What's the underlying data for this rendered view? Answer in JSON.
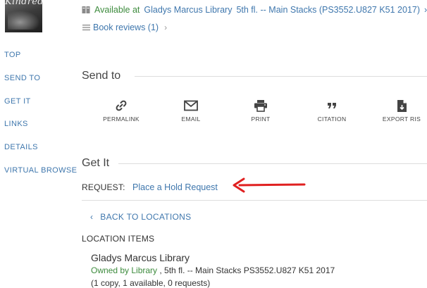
{
  "cover": {
    "title_text": "Kindred"
  },
  "availability": {
    "status": "Available at",
    "library": "Gladys Marcus Library",
    "location": "5th fl. -- Main Stacks (PS3552.U827 K51 2017)",
    "overflow_glyph": "›"
  },
  "reviews": {
    "label": "Book reviews (1)",
    "chevron": "›"
  },
  "nav": {
    "items": [
      "TOP",
      "SEND TO",
      "GET IT",
      "LINKS",
      "DETAILS",
      "VIRTUAL BROWSE"
    ]
  },
  "send_to": {
    "title": "Send to",
    "actions": [
      {
        "label": "PERMALINK",
        "icon": "link-icon"
      },
      {
        "label": "EMAIL",
        "icon": "email-icon"
      },
      {
        "label": "PRINT",
        "icon": "print-icon"
      },
      {
        "label": "CITATION",
        "icon": "quote-icon"
      },
      {
        "label": "EXPORT RIS",
        "icon": "file-export-icon"
      }
    ]
  },
  "get_it": {
    "title": "Get It",
    "request_label": "REQUEST:",
    "request_link": "Place a Hold Request",
    "back_link": "BACK TO LOCATIONS",
    "location_items_label": "LOCATION ITEMS",
    "library_name": "Gladys Marcus Library",
    "owned_by": "Owned by Library",
    "owned_location": " , 5th fl. -- Main Stacks PS3552.U827 K51 2017",
    "copies": "(1 copy, 1 available, 0 requests)"
  },
  "colors": {
    "link": "#3f77ad",
    "available": "#3d8b3d",
    "annotation_arrow": "#e02020"
  }
}
